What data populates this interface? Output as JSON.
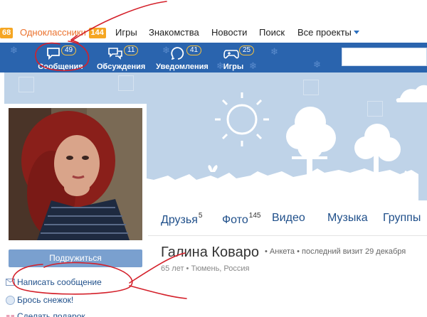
{
  "topnav": {
    "left_count": "68",
    "brand": "Одноклассники",
    "brand_badge": "144",
    "links": [
      "Игры",
      "Знакомства",
      "Новости",
      "Поиск",
      "Все проекты"
    ]
  },
  "toolbar": {
    "items": [
      {
        "label": "Сообщения",
        "count": "49",
        "icon": "speech-bubble-icon"
      },
      {
        "label": "Обсуждения",
        "count": "11",
        "icon": "discussion-icon"
      },
      {
        "label": "Уведомления",
        "count": "41",
        "icon": "notification-icon"
      },
      {
        "label": "Игры",
        "count": "25",
        "icon": "gamepad-icon"
      }
    ]
  },
  "profile": {
    "name": "Галина Коваро",
    "meta": "• Анкета • последний визит 29 декабря",
    "location": "65 лет • Тюмень, Россия",
    "tabs": [
      {
        "label": "Друзья",
        "count": "5"
      },
      {
        "label": "Фото",
        "count": "145"
      },
      {
        "label": "Видео",
        "count": ""
      },
      {
        "label": "Музыка",
        "count": ""
      },
      {
        "label": "Группы",
        "count": ""
      }
    ]
  },
  "actions": {
    "friend_button": "Подружиться",
    "write_message": "Написать сообщение",
    "throw_snowball": "Брось снежок!",
    "send_gift": "Сделать подарок"
  },
  "colors": {
    "toolbar_blue": "#2a64ae",
    "brand_orange": "#eb722e",
    "badge_orange": "#f5a623",
    "annotation_red": "#d4202a"
  }
}
